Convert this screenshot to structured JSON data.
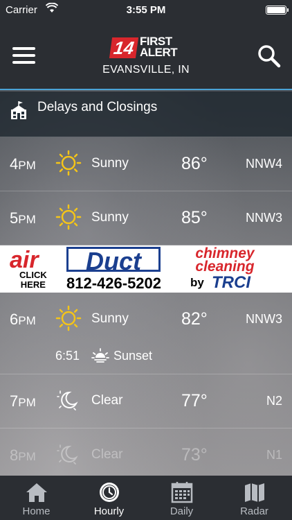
{
  "status_bar": {
    "carrier": "Carrier",
    "time": "3:55 PM"
  },
  "header": {
    "logo_number": "14",
    "logo_line1": "FIRST",
    "logo_line2": "ALERT",
    "location": "EVANSVILLE, IN"
  },
  "delays": {
    "label": "Delays and Closings",
    "icon": "school-icon"
  },
  "hourly": [
    {
      "hour": "4",
      "ampm": "PM",
      "condition": "Sunny",
      "icon": "sun-icon",
      "temp": "86°",
      "wind": "NNW4"
    },
    {
      "hour": "5",
      "ampm": "PM",
      "condition": "Sunny",
      "icon": "sun-icon",
      "temp": "85°",
      "wind": "NNW3"
    },
    {
      "hour": "6",
      "ampm": "PM",
      "condition": "Sunny",
      "icon": "sun-icon",
      "temp": "82°",
      "wind": "NNW3",
      "sunset_time": "6:51",
      "sunset_label": "Sunset"
    },
    {
      "hour": "7",
      "ampm": "PM",
      "condition": "Clear",
      "icon": "moon-icon",
      "temp": "77°",
      "wind": "N2"
    },
    {
      "hour": "8",
      "ampm": "PM",
      "condition": "Clear",
      "icon": "moon-icon",
      "temp": "73°",
      "wind": "N1"
    }
  ],
  "ad": {
    "air": "air",
    "duct": "Duct",
    "chimney_line1": "chimney",
    "chimney_line2": "cleaning",
    "click_line1": "CLICK",
    "click_line2": "HERE",
    "phone": "812-426-5202",
    "by": "by",
    "brand": "TRCI"
  },
  "tabs": [
    {
      "label": "Home",
      "icon": "home-icon",
      "active": false
    },
    {
      "label": "Hourly",
      "icon": "clock-icon",
      "active": true
    },
    {
      "label": "Daily",
      "icon": "calendar-icon",
      "active": false
    },
    {
      "label": "Radar",
      "icon": "map-icon",
      "active": false
    }
  ],
  "colors": {
    "accent": "#4aa3d6",
    "sun": "#f5c518",
    "logo_red": "#d8262c",
    "ad_blue": "#1b3f8f"
  }
}
